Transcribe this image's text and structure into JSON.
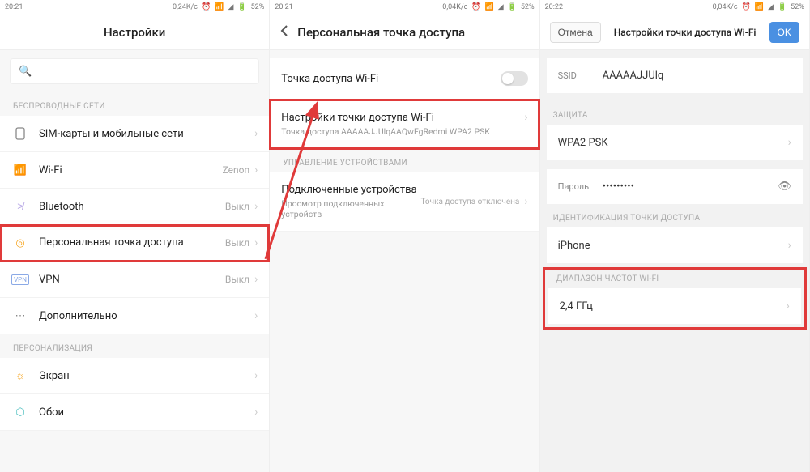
{
  "status": {
    "time1": "20:21",
    "time2": "20:21",
    "time3": "20:22",
    "net1": "0,24K/c",
    "net2": "0,04K/c",
    "net3": "0,04K/c",
    "battery": "52%"
  },
  "p1": {
    "title": "Настройки",
    "sec1": "БЕСПРОВОДНЫЕ СЕТИ",
    "sim": "SIM-карты и мобильные сети",
    "wifi": "Wi-Fi",
    "wifiVal": "Zenon",
    "bt": "Bluetooth",
    "btVal": "Выкл",
    "hotspot": "Персональная точка доступа",
    "hotspotVal": "Выкл",
    "vpn": "VPN",
    "vpnVal": "Выкл",
    "more": "Дополнительно",
    "sec2": "ПЕРСОНАЛИЗАЦИЯ",
    "screen": "Экран",
    "wall": "Обои"
  },
  "p2": {
    "title": "Персональная точка доступа",
    "toggleLabel": "Точка доступа Wi-Fi",
    "settingsLabel": "Настройки точки доступа Wi-Fi",
    "settingsSub": "Точка доступа AAAAAJJUlqAAQwFgRedmi WPA2 PSK",
    "sec": "УПРАВЛЕНИЕ УСТРОЙСТВАМИ",
    "connected": "Подключенные устройства",
    "connectedSub": "Просмотр подключенных устройств",
    "connectedVal": "Точка доступа отключена"
  },
  "p3": {
    "cancel": "Отмена",
    "ok": "OK",
    "title": "Настройки точки доступа Wi-Fi",
    "ssidLabel": "SSID",
    "ssid": "AAAAAJJUlq",
    "sec1": "ЗАЩИТА",
    "sec": "WPA2 PSK",
    "passLabel": "Пароль",
    "passVal": "•••••••••",
    "sec2": "ИДЕНТИФИКАЦИЯ ТОЧКИ ДОСТУПА",
    "ident": "iPhone",
    "sec3": "ДИАПАЗОН ЧАСТОТ WI-FI",
    "freq": "2,4 ГГц"
  }
}
